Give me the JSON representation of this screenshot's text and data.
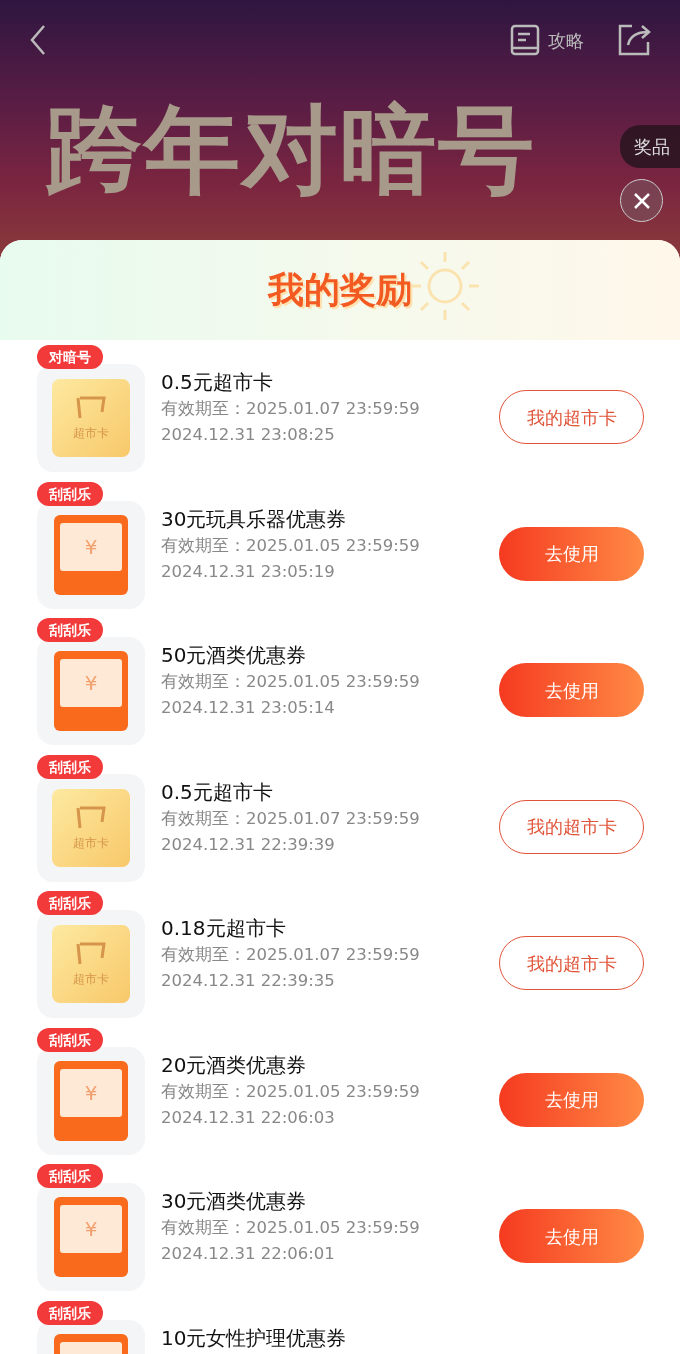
{
  "header": {
    "guide_label": "攻略",
    "banner_title": "跨年对暗号",
    "prizes_tab": "奖品"
  },
  "sheet": {
    "title": "我的奖励"
  },
  "rewards": [
    {
      "kind": "card",
      "badge": "对暗号",
      "icon_label": "超市卡",
      "title": "0.5元超市卡",
      "expiry": "有效期至：2025.01.07 23:59:59",
      "time": "2024.12.31 23:08:25",
      "button": {
        "label": "我的超市卡",
        "kind": "outline"
      }
    },
    {
      "kind": "coupon",
      "badge": "刮刮乐",
      "icon_label": "¥",
      "title": "30元玩具乐器优惠券",
      "expiry": "有效期至：2025.01.05 23:59:59",
      "time": "2024.12.31 23:05:19",
      "button": {
        "label": "去使用",
        "kind": "filled"
      }
    },
    {
      "kind": "coupon",
      "badge": "刮刮乐",
      "icon_label": "¥",
      "title": "50元酒类优惠券",
      "expiry": "有效期至：2025.01.05 23:59:59",
      "time": "2024.12.31 23:05:14",
      "button": {
        "label": "去使用",
        "kind": "filled"
      }
    },
    {
      "kind": "card",
      "badge": "刮刮乐",
      "icon_label": "超市卡",
      "title": "0.5元超市卡",
      "expiry": "有效期至：2025.01.07 23:59:59",
      "time": "2024.12.31 22:39:39",
      "button": {
        "label": "我的超市卡",
        "kind": "outline"
      }
    },
    {
      "kind": "card",
      "badge": "刮刮乐",
      "icon_label": "超市卡",
      "title": "0.18元超市卡",
      "expiry": "有效期至：2025.01.07 23:59:59",
      "time": "2024.12.31 22:39:35",
      "button": {
        "label": "我的超市卡",
        "kind": "outline"
      }
    },
    {
      "kind": "coupon",
      "badge": "刮刮乐",
      "icon_label": "¥",
      "title": "20元酒类优惠券",
      "expiry": "有效期至：2025.01.05 23:59:59",
      "time": "2024.12.31 22:06:03",
      "button": {
        "label": "去使用",
        "kind": "filled"
      }
    },
    {
      "kind": "coupon",
      "badge": "刮刮乐",
      "icon_label": "¥",
      "title": "30元酒类优惠券",
      "expiry": "有效期至：2025.01.05 23:59:59",
      "time": "2024.12.31 22:06:01",
      "button": {
        "label": "去使用",
        "kind": "filled"
      }
    },
    {
      "kind": "coupon",
      "badge": "刮刮乐",
      "title": "10元女性护理优惠券"
    }
  ]
}
